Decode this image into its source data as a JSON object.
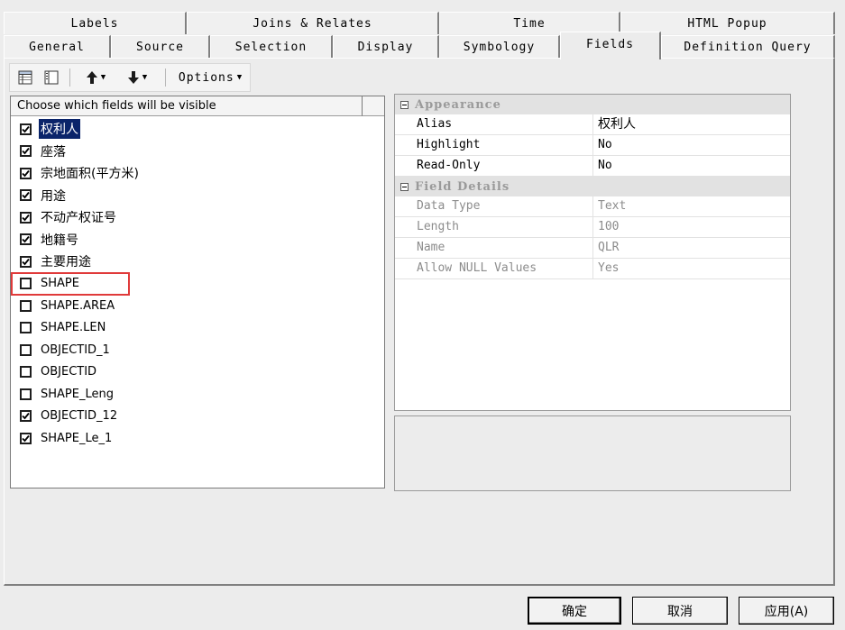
{
  "tabs": {
    "row1": [
      {
        "label": "Labels"
      },
      {
        "label": "Joins & Relates"
      },
      {
        "label": "Time"
      },
      {
        "label": "HTML Popup"
      }
    ],
    "row2": [
      {
        "label": "General"
      },
      {
        "label": "Source"
      },
      {
        "label": "Selection"
      },
      {
        "label": "Display"
      },
      {
        "label": "Symbology"
      },
      {
        "label": "Fields"
      },
      {
        "label": "Definition Query"
      }
    ],
    "active": "Fields"
  },
  "toolbar": {
    "table_view_icon": "table-view-icon",
    "list_view_icon": "list-view-icon",
    "move_up_icon": "arrow-up-icon",
    "move_down_icon": "arrow-down-icon",
    "options_label": "Options"
  },
  "field_list": {
    "header": "Choose which fields will be visible",
    "items": [
      {
        "label": "权利人",
        "checked": true,
        "selected": true
      },
      {
        "label": "座落",
        "checked": true
      },
      {
        "label": "宗地面积(平方米)",
        "checked": true
      },
      {
        "label": "用途",
        "checked": true
      },
      {
        "label": "不动产权证号",
        "checked": true
      },
      {
        "label": "地籍号",
        "checked": true
      },
      {
        "label": "主要用途",
        "checked": true
      },
      {
        "label": "SHAPE",
        "checked": false
      },
      {
        "label": "SHAPE.AREA",
        "checked": false
      },
      {
        "label": "SHAPE.LEN",
        "checked": false
      },
      {
        "label": "OBJECTID_1",
        "checked": false
      },
      {
        "label": "OBJECTID",
        "checked": false
      },
      {
        "label": "SHAPE_Leng",
        "checked": false
      },
      {
        "label": "OBJECTID_12",
        "checked": true
      },
      {
        "label": "SHAPE_Le_1",
        "checked": true
      }
    ],
    "highlight_color": "#e03a3a",
    "selection_color": "#0a246a"
  },
  "properties": {
    "appearance": {
      "title": "Appearance",
      "rows": [
        {
          "name": "Alias",
          "value": "权利人"
        },
        {
          "name": "Highlight",
          "value": "No"
        },
        {
          "name": "Read-Only",
          "value": "No"
        }
      ]
    },
    "details": {
      "title": "Field Details",
      "rows": [
        {
          "name": "Data Type",
          "value": "Text"
        },
        {
          "name": "Length",
          "value": "100"
        },
        {
          "name": "Name",
          "value": "QLR"
        },
        {
          "name": "Allow NULL Values",
          "value": "Yes"
        }
      ]
    }
  },
  "buttons": {
    "ok": "确定",
    "cancel": "取消",
    "apply": "应用(A)"
  }
}
